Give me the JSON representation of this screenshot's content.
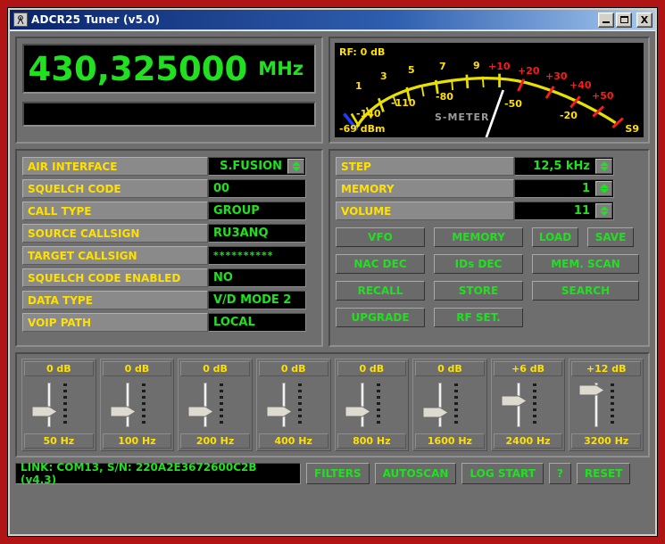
{
  "window": {
    "title": "ADCR25 Tuner (v5.0)",
    "icon": "antenna-icon",
    "minimize_label": "Minimize",
    "maximize_label": "Maximize",
    "close_label": "X"
  },
  "frequency": {
    "value": "430,325000",
    "unit": "MHz",
    "secondary_value": ""
  },
  "smeter": {
    "rf_label": "RF: 0 dB",
    "dbm_label": "-69 dBm",
    "s_label": "S9",
    "caption": "S-METER",
    "s_ticks": [
      "1",
      "3",
      "5",
      "7",
      "9"
    ],
    "plus_ticks": [
      "+10",
      "+20",
      "+30",
      "+40",
      "+50"
    ],
    "dbm_ticks": [
      "-140",
      "-110",
      "-80",
      "-50",
      "-20"
    ],
    "colors": {
      "scale": "#e8e000",
      "plus": "#ff1a1a",
      "low": "#1e3cff",
      "needle": "#ffffff",
      "caption": "#9a9a9a"
    }
  },
  "left_fields": [
    {
      "name": "AIR INTERFACE",
      "value": "S.FUSION",
      "spinner": true
    },
    {
      "name": "SQUELCH CODE",
      "value": "00",
      "spinner": false
    },
    {
      "name": "CALL TYPE",
      "value": "GROUP",
      "spinner": false
    },
    {
      "name": "SOURCE CALLSIGN",
      "value": "RU3ANQ",
      "spinner": false
    },
    {
      "name": "TARGET CALLSIGN",
      "value": "**********",
      "spinner": false
    },
    {
      "name": "SQUELCH CODE ENABLED",
      "value": "NO",
      "spinner": false
    },
    {
      "name": "DATA TYPE",
      "value": "V/D MODE 2",
      "spinner": false
    },
    {
      "name": "VOIP PATH",
      "value": "LOCAL",
      "spinner": false
    }
  ],
  "right_fields": [
    {
      "name": "STEP",
      "value": "12,5 kHz",
      "spinner": true
    },
    {
      "name": "MEMORY",
      "value": "1",
      "spinner": true
    },
    {
      "name": "VOLUME",
      "value": "11",
      "spinner": true
    }
  ],
  "buttons": {
    "row1": [
      {
        "label": "VFO",
        "size": "w100"
      },
      {
        "label": "MEMORY",
        "size": "w100"
      },
      {
        "label": "LOAD",
        "size": "w52"
      },
      {
        "label": "SAVE",
        "size": "w52"
      }
    ],
    "row2": [
      {
        "label": "NAC DEC",
        "size": "w100"
      },
      {
        "label": "IDs DEC",
        "size": "w100"
      },
      {
        "label": "MEM. SCAN",
        "size": "w120"
      }
    ],
    "row3": [
      {
        "label": "RECALL",
        "size": "w100"
      },
      {
        "label": "STORE",
        "size": "w100"
      },
      {
        "label": "SEARCH",
        "size": "w120"
      }
    ],
    "row4": [
      {
        "label": "UPGRADE",
        "size": "w100"
      },
      {
        "label": "RF SET.",
        "size": "w100"
      }
    ]
  },
  "equalizer": {
    "bands": [
      {
        "gain": "0 dB",
        "freq": "50 Hz",
        "pos": 50
      },
      {
        "gain": "0 dB",
        "freq": "100 Hz",
        "pos": 50
      },
      {
        "gain": "0 dB",
        "freq": "200 Hz",
        "pos": 50
      },
      {
        "gain": "0 dB",
        "freq": "400 Hz",
        "pos": 50
      },
      {
        "gain": "0 dB",
        "freq": "800 Hz",
        "pos": 50
      },
      {
        "gain": "0 dB",
        "freq": "1600 Hz",
        "pos": 52
      },
      {
        "gain": "+6 dB",
        "freq": "2400 Hz",
        "pos": 30
      },
      {
        "gain": "+12 dB",
        "freq": "3200 Hz",
        "pos": 8
      }
    ]
  },
  "status": {
    "link_text": "LINK: COM13, S/N: 220A2E3672600C2B (v4.3)",
    "buttons": [
      "FILTERS",
      "AUTOSCAN",
      "LOG START",
      "?",
      "RESET"
    ]
  }
}
